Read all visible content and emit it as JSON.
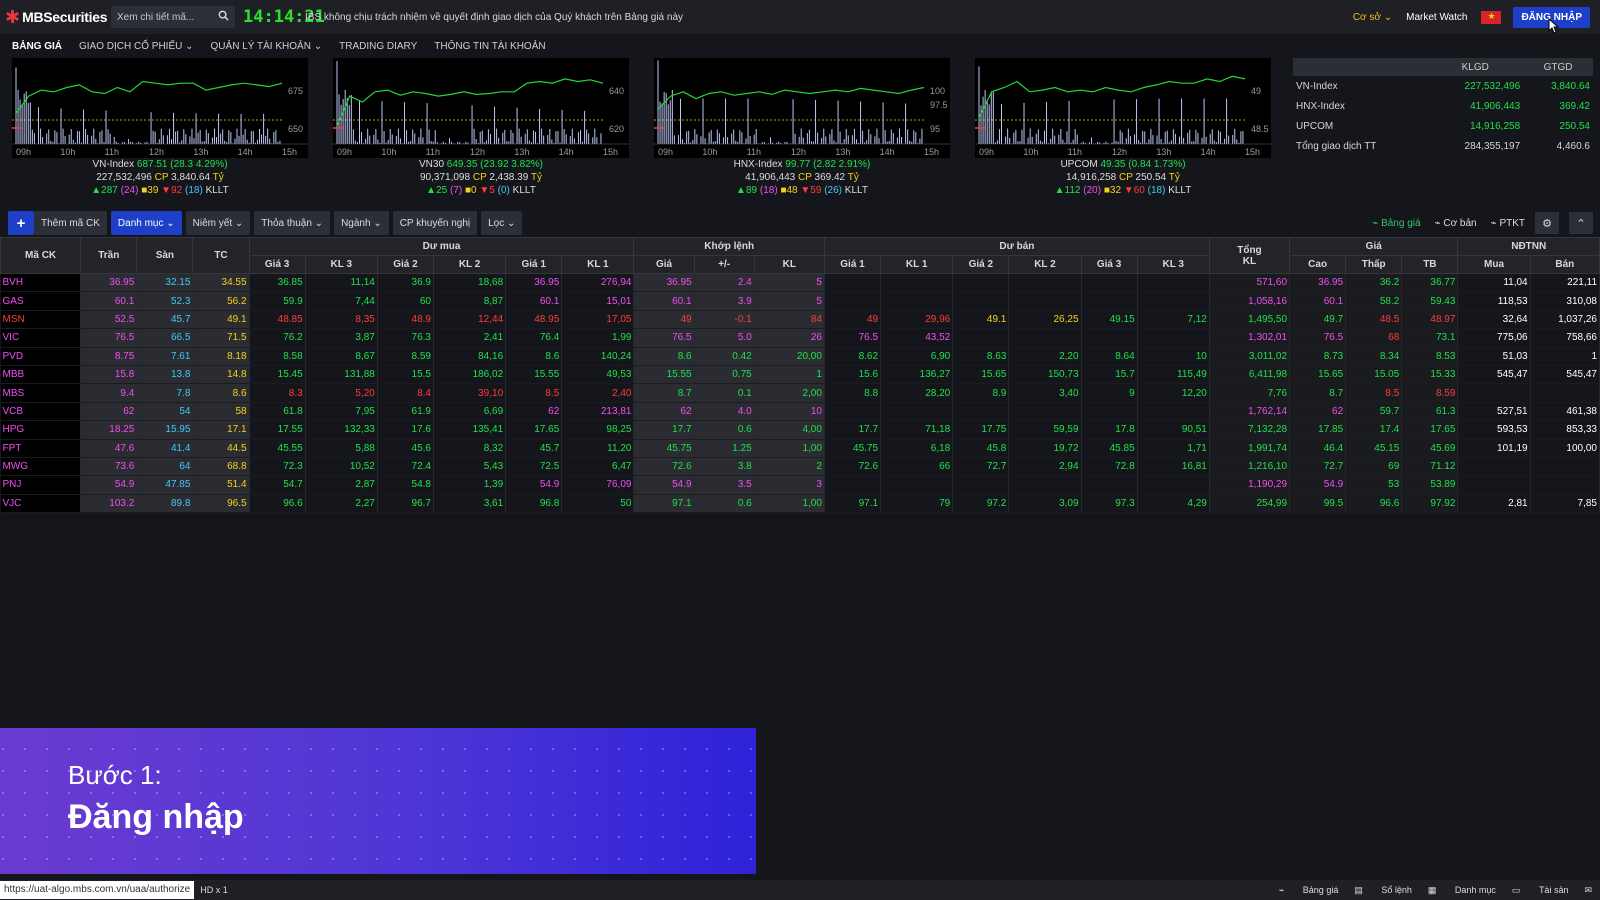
{
  "header": {
    "logo": "MBSecurities",
    "search_placeholder": "Xem chi tiết mã...",
    "clock": "14:14:21",
    "notice": "IBS không chịu trách nhiệm về quyết định giao dịch của Quý khách trên Bảng giá này",
    "market_select": "Cơ sở",
    "market_watch": "Market Watch",
    "login": "ĐĂNG NHẬP"
  },
  "menu": [
    "BẢNG GIÁ",
    "GIAO DỊCH CỔ PHIẾU",
    "QUẢN LÝ TÀI KHOẢN",
    "TRADING DIARY",
    "THÔNG TIN TÀI KHOẢN"
  ],
  "indices": [
    {
      "name": "VN-Index",
      "value": "687.51",
      "change": "(28.3 4.29%)",
      "vol": "227,532,496",
      "val": "3,840.64",
      "up": "287",
      "ce": "(24)",
      "ref": "39",
      "dn": "92",
      "fl": "(18)",
      "y_hi": "675",
      "y_lo": "650"
    },
    {
      "name": "VN30",
      "value": "649.35",
      "change": "(23.92 3.82%)",
      "vol": "90,371,098",
      "val": "2,438.39",
      "up": "25",
      "ce": "(7)",
      "ref": "0",
      "dn": "5",
      "fl": "(0)",
      "y_hi": "640",
      "y_lo": "620"
    },
    {
      "name": "HNX-Index",
      "value": "99.77",
      "change": "(2.82 2.91%)",
      "vol": "41,906,443",
      "val": "369.42",
      "up": "89",
      "ce": "(18)",
      "ref": "48",
      "dn": "59",
      "fl": "(26)",
      "y_hi": "100",
      "y_mid": "97.5",
      "y_lo": "95"
    },
    {
      "name": "UPCOM",
      "value": "49.35",
      "change": "(0.84 1.73%)",
      "vol": "14,916,258",
      "val": "250.54",
      "up": "112",
      "ce": "(20)",
      "ref": "32",
      "dn": "60",
      "fl": "(18)",
      "y_hi": "49",
      "y_lo": "48.5"
    }
  ],
  "time_ticks": [
    "09h",
    "10h",
    "11h",
    "12h",
    "13h",
    "14h",
    "15h"
  ],
  "labels": {
    "cp": "CP",
    "ty": "Tỷ",
    "kllt": "KLLT"
  },
  "summary": {
    "headers": [
      "",
      "KLGD",
      "GTGD"
    ],
    "rows": [
      [
        "VN-Index",
        "227,532,496",
        "3,840.64"
      ],
      [
        "HNX-Index",
        "41,906,443",
        "369.42"
      ],
      [
        "UPCOM",
        "14,916,258",
        "250.54"
      ],
      [
        "Tổng giao dịch TT",
        "284,355,197",
        "4,460.6"
      ]
    ]
  },
  "toolbar": {
    "add": "+",
    "add_label": "Thêm mã CK",
    "danhmuc": "Danh mục",
    "niemyet": "Niêm yết",
    "thoathuan": "Thỏa thuận",
    "nganh": "Ngành",
    "khuyennghi": "CP khuyến nghị",
    "loc": "Lọc",
    "banggia": "Bảng giá",
    "coban": "Cơ bản",
    "ptkt": "PTKT"
  },
  "board": {
    "h_top": {
      "ma": "Mã CK",
      "tran": "Trần",
      "san": "Sàn",
      "tc": "TC",
      "duomua": "Dư mua",
      "khop": "Khớp lệnh",
      "duban": "Dư bán",
      "tong": "Tổng",
      "tong2": "KL",
      "gia": "Giá",
      "ndtnn": "NĐTNN"
    },
    "h_sub": [
      "Giá 3",
      "KL 3",
      "Giá 2",
      "KL 2",
      "Giá 1",
      "KL 1",
      "Giá",
      "+/-",
      "KL",
      "Giá 1",
      "KL 1",
      "Giá 2",
      "KL 2",
      "Giá 3",
      "KL 3",
      "Cao",
      "Thấp",
      "TB",
      "Mua",
      "Bán"
    ],
    "rows": [
      {
        "c": [
          "BVH",
          "36.95",
          "32.15",
          "34.55",
          "36.85",
          "11,14",
          "36.9",
          "18,68",
          "36.95",
          "276,94",
          "36.95",
          "2.4",
          "5",
          "",
          "",
          "",
          "",
          "",
          "",
          "571,60",
          "36.95",
          "36.2",
          "36.77",
          "11,04",
          "221,11"
        ],
        "k": [
          "ce",
          "ce",
          "fl",
          "ref",
          "up",
          "up",
          "up",
          "up",
          "ce",
          "ce",
          "ce",
          "ce",
          "ce",
          "",
          "",
          "",
          "",
          "",
          "",
          "ce",
          "ce",
          "up",
          "up",
          "wh",
          "wh"
        ]
      },
      {
        "c": [
          "GAS",
          "60.1",
          "52.3",
          "56.2",
          "59.9",
          "7,44",
          "60",
          "8,87",
          "60.1",
          "15,01",
          "60.1",
          "3.9",
          "5",
          "",
          "",
          "",
          "",
          "",
          "",
          "1,058,16",
          "60.1",
          "58.2",
          "59.43",
          "118,53",
          "310,08"
        ],
        "k": [
          "ce",
          "ce",
          "fl",
          "ref",
          "up",
          "up",
          "up",
          "up",
          "ce",
          "ce",
          "ce",
          "ce",
          "ce",
          "",
          "",
          "",
          "",
          "",
          "",
          "ce",
          "ce",
          "up",
          "up",
          "wh",
          "wh"
        ]
      },
      {
        "c": [
          "MSN",
          "52.5",
          "45.7",
          "49.1",
          "48.85",
          "8,35",
          "48.9",
          "12,44",
          "48.95",
          "17,05",
          "49",
          "-0.1",
          "84",
          "49",
          "29,96",
          "49.1",
          "26,25",
          "49.15",
          "7,12",
          "1,495,50",
          "49.7",
          "48.5",
          "48.97",
          "32,64",
          "1,037,26"
        ],
        "k": [
          "dn",
          "ce",
          "fl",
          "ref",
          "dn",
          "dn",
          "dn",
          "dn",
          "dn",
          "dn",
          "dn",
          "dn",
          "dn",
          "dn",
          "dn",
          "ref",
          "ref",
          "up",
          "up",
          "up",
          "up",
          "dn",
          "dn",
          "wh",
          "wh"
        ]
      },
      {
        "c": [
          "VIC",
          "76.5",
          "66.5",
          "71.5",
          "76.2",
          "3,87",
          "76.3",
          "2,41",
          "76.4",
          "1,99",
          "76.5",
          "5.0",
          "26",
          "76.5",
          "43,52",
          "",
          "",
          "",
          "",
          "1,302,01",
          "76.5",
          "68",
          "73.1",
          "775,06",
          "758,66"
        ],
        "k": [
          "ce",
          "ce",
          "fl",
          "ref",
          "up",
          "up",
          "up",
          "up",
          "up",
          "up",
          "ce",
          "ce",
          "ce",
          "ce",
          "ce",
          "",
          "",
          "",
          "",
          "ce",
          "ce",
          "dn",
          "up",
          "wh",
          "wh"
        ]
      },
      {
        "c": [
          "PVD",
          "8.75",
          "7.61",
          "8.18",
          "8.58",
          "8,67",
          "8.59",
          "84,16",
          "8.6",
          "140,24",
          "8.6",
          "0.42",
          "20,00",
          "8.62",
          "6,90",
          "8.63",
          "2,20",
          "8.64",
          "10",
          "3,011,02",
          "8.73",
          "8.34",
          "8.53",
          "51,03",
          "1"
        ],
        "k": [
          "ce",
          "ce",
          "fl",
          "ref",
          "up",
          "up",
          "up",
          "up",
          "up",
          "up",
          "up",
          "up",
          "up",
          "up",
          "up",
          "up",
          "up",
          "up",
          "up",
          "up",
          "up",
          "up",
          "up",
          "wh",
          "wh"
        ]
      },
      {
        "c": [
          "MBB",
          "15.8",
          "13.8",
          "14.8",
          "15.45",
          "131,88",
          "15.5",
          "186,02",
          "15.55",
          "49,53",
          "15.55",
          "0.75",
          "1",
          "15.6",
          "136,27",
          "15.65",
          "150,73",
          "15.7",
          "115,49",
          "6,411,98",
          "15.65",
          "15.05",
          "15.33",
          "545,47",
          "545,47"
        ],
        "k": [
          "ce",
          "ce",
          "fl",
          "ref",
          "up",
          "up",
          "up",
          "up",
          "up",
          "up",
          "up",
          "up",
          "up",
          "up",
          "up",
          "up",
          "up",
          "up",
          "up",
          "up",
          "up",
          "up",
          "up",
          "wh",
          "wh"
        ]
      },
      {
        "c": [
          "MBS",
          "9.4",
          "7.8",
          "8.6",
          "8.3",
          "5,20",
          "8.4",
          "39,10",
          "8.5",
          "2,40",
          "8.7",
          "0.1",
          "2,00",
          "8.8",
          "28,20",
          "8.9",
          "3,40",
          "9",
          "12,20",
          "7,76",
          "8.7",
          "8.5",
          "8.59",
          "",
          ""
        ],
        "k": [
          "ce",
          "ce",
          "fl",
          "ref",
          "dn",
          "dn",
          "dn",
          "dn",
          "dn",
          "dn",
          "up",
          "up",
          "up",
          "up",
          "up",
          "up",
          "up",
          "up",
          "up",
          "up",
          "up",
          "dn",
          "dn",
          "wh",
          "wh"
        ]
      },
      {
        "c": [
          "VCB",
          "62",
          "54",
          "58",
          "61.8",
          "7,95",
          "61.9",
          "6,69",
          "62",
          "213,81",
          "62",
          "4.0",
          "10",
          "",
          "",
          "",
          "",
          "",
          "",
          "1,762,14",
          "62",
          "59.7",
          "61.3",
          "527,51",
          "461,38"
        ],
        "k": [
          "ce",
          "ce",
          "fl",
          "ref",
          "up",
          "up",
          "up",
          "up",
          "ce",
          "ce",
          "ce",
          "ce",
          "ce",
          "",
          "",
          "",
          "",
          "",
          "",
          "ce",
          "ce",
          "up",
          "up",
          "wh",
          "wh"
        ]
      },
      {
        "c": [
          "HPG",
          "18.25",
          "15.95",
          "17.1",
          "17.55",
          "132,33",
          "17.6",
          "135,41",
          "17.65",
          "98,25",
          "17.7",
          "0.6",
          "4,00",
          "17.7",
          "71,18",
          "17.75",
          "59,59",
          "17.8",
          "90,51",
          "7,132,28",
          "17.85",
          "17.4",
          "17.65",
          "593,53",
          "853,33"
        ],
        "k": [
          "ce",
          "ce",
          "fl",
          "ref",
          "up",
          "up",
          "up",
          "up",
          "up",
          "up",
          "up",
          "up",
          "up",
          "up",
          "up",
          "up",
          "up",
          "up",
          "up",
          "up",
          "up",
          "up",
          "up",
          "wh",
          "wh"
        ]
      },
      {
        "c": [
          "FPT",
          "47.6",
          "41.4",
          "44.5",
          "45.55",
          "5,88",
          "45.6",
          "8,32",
          "45.7",
          "11,20",
          "45.75",
          "1.25",
          "1,00",
          "45.75",
          "6,18",
          "45.8",
          "19,72",
          "45.85",
          "1,71",
          "1,991,74",
          "46.4",
          "45.15",
          "45.69",
          "101,19",
          "100,00"
        ],
        "k": [
          "ce",
          "ce",
          "fl",
          "ref",
          "up",
          "up",
          "up",
          "up",
          "up",
          "up",
          "up",
          "up",
          "up",
          "up",
          "up",
          "up",
          "up",
          "up",
          "up",
          "up",
          "up",
          "up",
          "up",
          "wh",
          "wh"
        ]
      },
      {
        "c": [
          "MWG",
          "73.6",
          "64",
          "68.8",
          "72.3",
          "10,52",
          "72.4",
          "5,43",
          "72.5",
          "6,47",
          "72.6",
          "3.8",
          "2",
          "72.6",
          "66",
          "72.7",
          "2,94",
          "72.8",
          "16,81",
          "1,216,10",
          "72.7",
          "69",
          "71.12",
          "",
          ""
        ],
        "k": [
          "ce",
          "ce",
          "fl",
          "ref",
          "up",
          "up",
          "up",
          "up",
          "up",
          "up",
          "up",
          "up",
          "up",
          "up",
          "up",
          "up",
          "up",
          "up",
          "up",
          "up",
          "up",
          "up",
          "up",
          "wh",
          "wh"
        ]
      },
      {
        "c": [
          "PNJ",
          "54.9",
          "47.85",
          "51.4",
          "54.7",
          "2,87",
          "54.8",
          "1,39",
          "54.9",
          "76,09",
          "54.9",
          "3.5",
          "3",
          "",
          "",
          "",
          "",
          "",
          "",
          "1,190,29",
          "54.9",
          "53",
          "53.89",
          "",
          ""
        ],
        "k": [
          "ce",
          "ce",
          "fl",
          "ref",
          "up",
          "up",
          "up",
          "up",
          "ce",
          "ce",
          "ce",
          "ce",
          "ce",
          "",
          "",
          "",
          "",
          "",
          "",
          "ce",
          "ce",
          "up",
          "up",
          "wh",
          "wh"
        ]
      },
      {
        "c": [
          "VJC",
          "103.2",
          "89.8",
          "96.5",
          "96.6",
          "2,27",
          "96.7",
          "3,61",
          "96.8",
          "50",
          "97.1",
          "0.6",
          "1,00",
          "97.1",
          "79",
          "97.2",
          "3,09",
          "97.3",
          "4,29",
          "254,99",
          "99.5",
          "96.6",
          "97.92",
          "2,81",
          "7,85"
        ],
        "k": [
          "ce",
          "ce",
          "fl",
          "ref",
          "up",
          "up",
          "up",
          "up",
          "up",
          "up",
          "up",
          "up",
          "up",
          "up",
          "up",
          "up",
          "up",
          "up",
          "up",
          "up",
          "up",
          "up",
          "up",
          "wh",
          "wh"
        ]
      }
    ]
  },
  "banner": {
    "line1": "Bước 1:",
    "line2": "Đăng nhập"
  },
  "statusbar": {
    "url": "https://uat-algo.mbs.com.vn/uaa/authorize",
    "hd": "HD x 1",
    "items": [
      "Bảng giá",
      "Sổ lệnh",
      "Danh mục",
      "Tài sản"
    ]
  }
}
